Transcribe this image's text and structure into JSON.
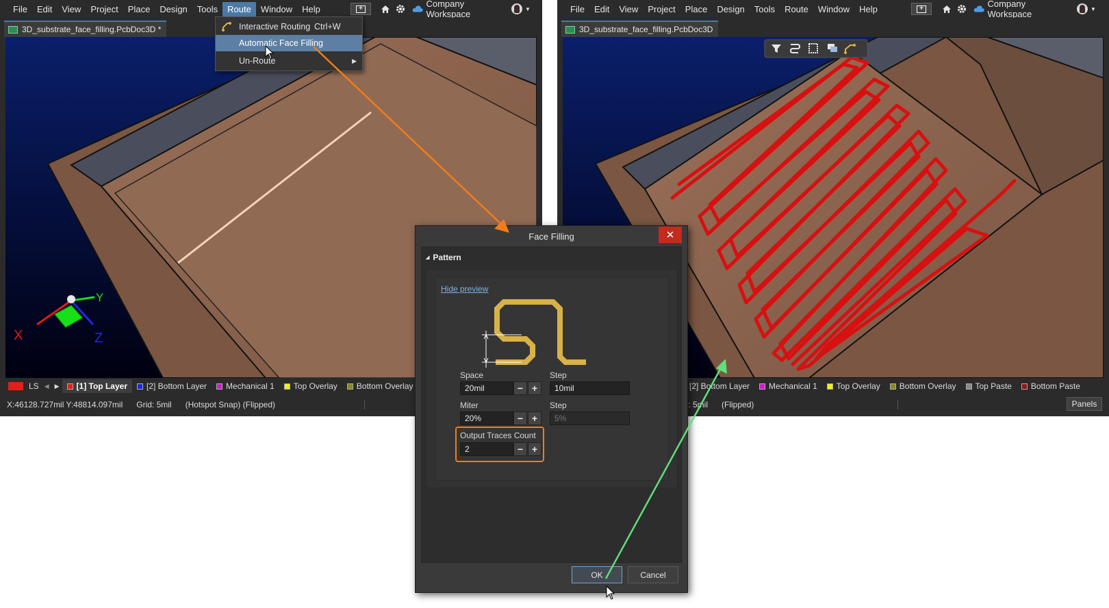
{
  "menus": [
    "File",
    "Edit",
    "View",
    "Project",
    "Place",
    "Design",
    "Tools",
    "Route",
    "Window",
    "Help"
  ],
  "workspace": "Company Workspace",
  "left_window": {
    "tab": "3D_substrate_face_filling.PcbDoc3D *",
    "layer_ls": "LS",
    "layers": [
      {
        "label": "[1] Top Layer",
        "color": "#e0201a",
        "active": true
      },
      {
        "label": "[2] Bottom Layer",
        "color": "#1a2ce0"
      },
      {
        "label": "Mechanical 1",
        "color": "#d21ad2"
      },
      {
        "label": "Top Overlay",
        "color": "#f0f01a"
      },
      {
        "label": "Bottom Overlay",
        "color": "#8a8a1a"
      }
    ],
    "status": {
      "coords": "X:46128.727mil Y:48814.097mil",
      "grid": "Grid: 5mil",
      "snap": "(Hotspot Snap) (Flipped)"
    },
    "axes": {
      "x": "X",
      "y": "Y",
      "z": "Z"
    }
  },
  "right_window": {
    "tab": "3D_substrate_face_filling.PcbDoc3D",
    "layers": [
      {
        "label": "[2] Bottom Layer",
        "color": "#1a2ce0"
      },
      {
        "label": "Mechanical 1",
        "color": "#d21ad2"
      },
      {
        "label": "Top Overlay",
        "color": "#f0f01a"
      },
      {
        "label": "Bottom Overlay",
        "color": "#8a8a1a"
      },
      {
        "label": "Top Paste",
        "color": "#8a8a8a"
      },
      {
        "label": "Bottom Paste",
        "color": "#8a1a1a"
      }
    ],
    "status": {
      "grid": "id: 5mil",
      "flipped": "(Flipped)"
    },
    "panels": "Panels"
  },
  "route_menu": {
    "items": [
      {
        "label": "Interactive Routing",
        "shortcut": "Ctrl+W"
      },
      {
        "label": "Automatic Face Filling",
        "shortcut": ""
      },
      {
        "label": "Un-Route",
        "shortcut": ""
      }
    ]
  },
  "dialog": {
    "title": "Face Filling",
    "close": "✕",
    "section": "Pattern",
    "hide_preview": "Hide preview",
    "space_label": "Space",
    "space_value": "20mil",
    "space_step_label": "Step",
    "space_step_value": "10mil",
    "miter_label": "Miter",
    "miter_value": "20%",
    "miter_step_label": "Step",
    "miter_step_value": "5%",
    "traces_label": "Output Traces Count",
    "traces_value": "2",
    "ok": "OK",
    "cancel": "Cancel"
  },
  "colors": {
    "highlight": "#f07d1a",
    "arrow_green": "#5fe07a",
    "trace_red": "#d81010",
    "preview_gold": "#d8b248"
  }
}
